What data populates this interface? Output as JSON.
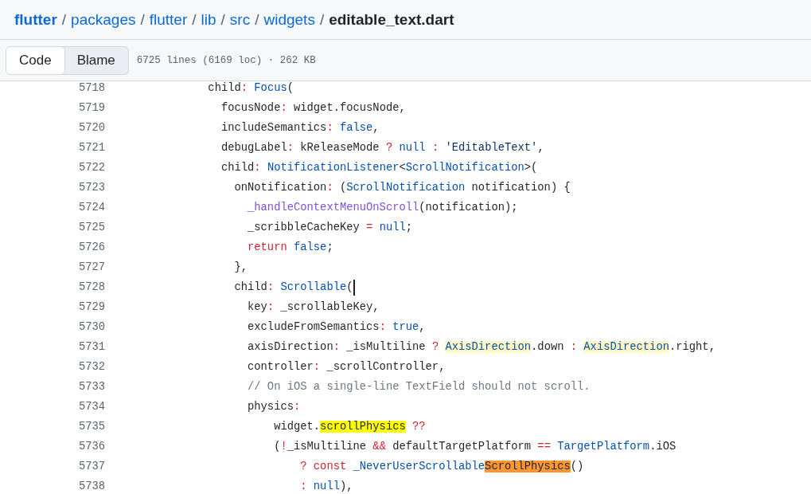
{
  "breadcrumb": {
    "separator": "/",
    "items": [
      {
        "label": "flutter",
        "kind": "repo"
      },
      {
        "label": "packages",
        "kind": "dir"
      },
      {
        "label": "flutter",
        "kind": "dir"
      },
      {
        "label": "lib",
        "kind": "dir"
      },
      {
        "label": "src",
        "kind": "dir"
      },
      {
        "label": "widgets",
        "kind": "dir"
      },
      {
        "label": "editable_text.dart",
        "kind": "file"
      }
    ]
  },
  "view_tabs": [
    {
      "label": "Code",
      "selected": true
    },
    {
      "label": "Blame",
      "selected": false
    }
  ],
  "file_info": "6725 lines (6169 loc) · 262 KB",
  "code_lines": [
    {
      "number": "5718",
      "tokens": [
        {
          "text": "            child",
          "kind": "plain"
        },
        {
          "text": ": ",
          "kind": "op"
        },
        {
          "text": "Focus",
          "kind": "type"
        },
        {
          "text": "(",
          "kind": "plain"
        }
      ]
    },
    {
      "number": "5719",
      "tokens": [
        {
          "text": "              focusNode",
          "kind": "plain"
        },
        {
          "text": ":",
          "kind": "op"
        },
        {
          "text": " widget.focusNode,",
          "kind": "plain"
        }
      ]
    },
    {
      "number": "5720",
      "tokens": [
        {
          "text": "              includeSemantics",
          "kind": "plain"
        },
        {
          "text": ": ",
          "kind": "op"
        },
        {
          "text": "false",
          "kind": "type"
        },
        {
          "text": ",",
          "kind": "plain"
        }
      ]
    },
    {
      "number": "5721",
      "tokens": [
        {
          "text": "              debugLabel",
          "kind": "plain"
        },
        {
          "text": ":",
          "kind": "op"
        },
        {
          "text": " kReleaseMode ",
          "kind": "plain"
        },
        {
          "text": "? ",
          "kind": "op"
        },
        {
          "text": "null ",
          "kind": "type"
        },
        {
          "text": ": ",
          "kind": "op"
        },
        {
          "text": "'EditableText'",
          "kind": "string"
        },
        {
          "text": ",",
          "kind": "plain"
        }
      ]
    },
    {
      "number": "5722",
      "tokens": [
        {
          "text": "              child",
          "kind": "plain"
        },
        {
          "text": ": ",
          "kind": "op"
        },
        {
          "text": "NotificationListener",
          "kind": "type"
        },
        {
          "text": "<",
          "kind": "plain"
        },
        {
          "text": "ScrollNotification",
          "kind": "type"
        },
        {
          "text": ">(",
          "kind": "plain"
        }
      ]
    },
    {
      "number": "5723",
      "tokens": [
        {
          "text": "                onNotification",
          "kind": "plain"
        },
        {
          "text": ":",
          "kind": "op"
        },
        {
          "text": " (",
          "kind": "plain"
        },
        {
          "text": "ScrollNotification",
          "kind": "type"
        },
        {
          "text": " notification) {",
          "kind": "plain"
        }
      ]
    },
    {
      "number": "5724",
      "tokens": [
        {
          "text": "                  _handleContextMenuOnScroll",
          "kind": "func"
        },
        {
          "text": "(notification);",
          "kind": "plain"
        }
      ]
    },
    {
      "number": "5725",
      "tokens": [
        {
          "text": "                  _scribbleCacheKey ",
          "kind": "plain"
        },
        {
          "text": "= ",
          "kind": "op"
        },
        {
          "text": "null",
          "kind": "type"
        },
        {
          "text": ";",
          "kind": "plain"
        }
      ]
    },
    {
      "number": "5726",
      "tokens": [
        {
          "text": "                  return ",
          "kind": "op"
        },
        {
          "text": "false",
          "kind": "type"
        },
        {
          "text": ";",
          "kind": "plain"
        }
      ]
    },
    {
      "number": "5727",
      "tokens": [
        {
          "text": "                },",
          "kind": "plain"
        }
      ]
    },
    {
      "number": "5728",
      "caret": true,
      "tokens": [
        {
          "text": "                child",
          "kind": "plain"
        },
        {
          "text": ": ",
          "kind": "op"
        },
        {
          "text": "Scrollable",
          "kind": "type"
        },
        {
          "text": "(",
          "kind": "plain"
        }
      ]
    },
    {
      "number": "5729",
      "tokens": [
        {
          "text": "                  key",
          "kind": "plain"
        },
        {
          "text": ":",
          "kind": "op"
        },
        {
          "text": " _scrollableKey,",
          "kind": "plain"
        }
      ]
    },
    {
      "number": "5730",
      "tokens": [
        {
          "text": "                  excludeFromSemantics",
          "kind": "plain"
        },
        {
          "text": ": ",
          "kind": "op"
        },
        {
          "text": "true",
          "kind": "type"
        },
        {
          "text": ",",
          "kind": "plain"
        }
      ]
    },
    {
      "number": "5731",
      "tokens": [
        {
          "text": "                  axisDirection",
          "kind": "plain"
        },
        {
          "text": ":",
          "kind": "op"
        },
        {
          "text": " _isMultiline ",
          "kind": "plain"
        },
        {
          "text": "? ",
          "kind": "op"
        },
        {
          "text": "AxisDirection",
          "kind": "type",
          "color": "#fff8c5"
        },
        {
          "text": ".down ",
          "kind": "plain"
        },
        {
          "text": ": ",
          "kind": "op"
        },
        {
          "text": "AxisDirection",
          "kind": "type",
          "color": "#fff8c5"
        },
        {
          "text": ".right,",
          "kind": "plain"
        }
      ]
    },
    {
      "number": "5732",
      "tokens": [
        {
          "text": "                  controller",
          "kind": "plain"
        },
        {
          "text": ":",
          "kind": "op"
        },
        {
          "text": " _scrollController,",
          "kind": "plain"
        }
      ]
    },
    {
      "number": "5733",
      "tokens": [
        {
          "text": "                  // On iOS a single-line TextField should not scroll.",
          "kind": "comment"
        }
      ]
    },
    {
      "number": "5734",
      "tokens": [
        {
          "text": "                  physics",
          "kind": "plain"
        },
        {
          "text": ":",
          "kind": "op"
        }
      ]
    },
    {
      "number": "5735",
      "tokens": [
        {
          "text": "                      widget.",
          "kind": "plain"
        },
        {
          "text": "scrollPhysics",
          "kind": "plain",
          "color": "#ffff00"
        },
        {
          "text": " ??",
          "kind": "op"
        }
      ]
    },
    {
      "number": "5736",
      "tokens": [
        {
          "text": "                      (",
          "kind": "plain"
        },
        {
          "text": "!",
          "kind": "op"
        },
        {
          "text": "_isMultiline ",
          "kind": "plain"
        },
        {
          "text": "&&",
          "kind": "op"
        },
        {
          "text": " defaultTargetPlatform ",
          "kind": "plain"
        },
        {
          "text": "== ",
          "kind": "op"
        },
        {
          "text": "TargetPlatform",
          "kind": "type"
        },
        {
          "text": ".iOS",
          "kind": "plain"
        }
      ]
    },
    {
      "number": "5737",
      "tokens": [
        {
          "text": "                          ? const ",
          "kind": "op"
        },
        {
          "text": "_NeverUserScrollable",
          "kind": "type"
        },
        {
          "text": "ScrollPhysics",
          "kind": "plain",
          "color": "#ff9632"
        },
        {
          "text": "()",
          "kind": "plain"
        }
      ]
    },
    {
      "number": "5738",
      "tokens": [
        {
          "text": "                          : ",
          "kind": "op"
        },
        {
          "text": "null",
          "kind": "type"
        },
        {
          "text": "),",
          "kind": "plain"
        }
      ]
    }
  ]
}
